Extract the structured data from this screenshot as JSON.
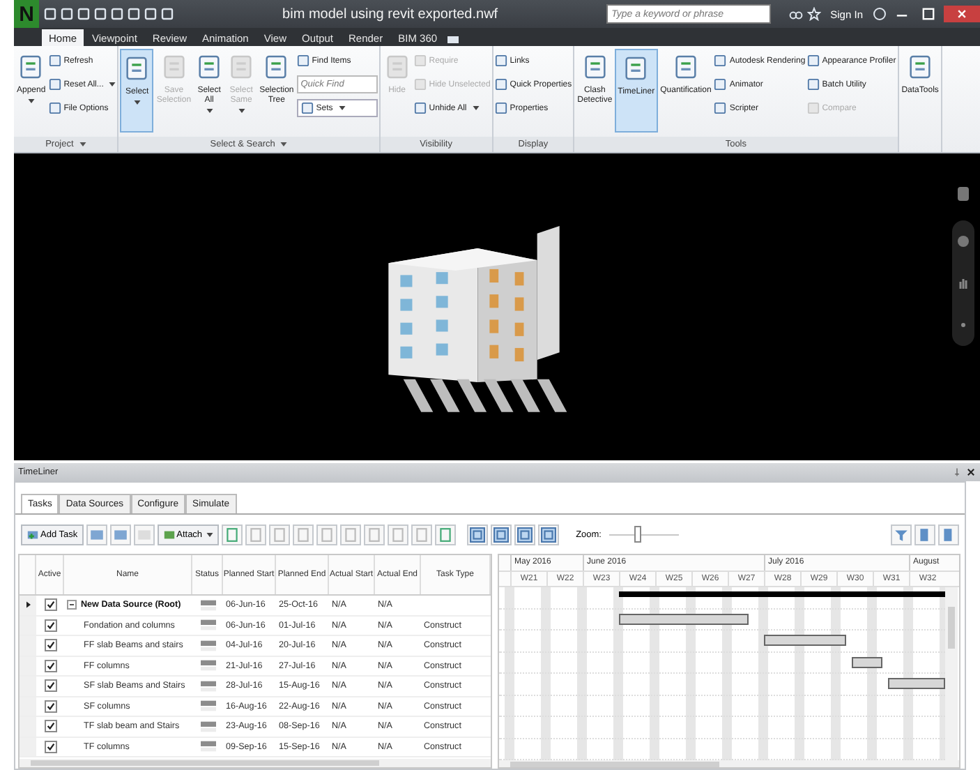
{
  "window": {
    "app_letter": "N",
    "title": "bim model using revit exported.nwf"
  },
  "search": {
    "placeholder": "Type a keyword or phrase"
  },
  "sign_in": "Sign In",
  "ribbon_tabs": [
    {
      "label": "Home",
      "selected": true
    },
    {
      "label": "Viewpoint",
      "selected": false
    },
    {
      "label": "Review",
      "selected": false
    },
    {
      "label": "Animation",
      "selected": false
    },
    {
      "label": "View",
      "selected": false
    },
    {
      "label": "Output",
      "selected": false
    },
    {
      "label": "Render",
      "selected": false
    },
    {
      "label": "BIM 360",
      "selected": false
    }
  ],
  "ribbon_groups": [
    {
      "label": "Project",
      "caret": true,
      "items": [
        {
          "kind": "large",
          "label": "Append",
          "selected": false,
          "disabled": false,
          "caret": true
        },
        {
          "kind": "stack",
          "items": [
            {
              "kind": "button",
              "label": "Refresh",
              "disabled": false,
              "caret": false
            },
            {
              "kind": "button",
              "label": "Reset All...",
              "disabled": false,
              "caret": true
            },
            {
              "kind": "button",
              "label": "File Options",
              "disabled": false,
              "caret": false
            }
          ]
        }
      ]
    },
    {
      "label": "Select & Search",
      "caret": true,
      "items": [
        {
          "kind": "large",
          "label": "Select",
          "selected": true,
          "disabled": false,
          "caret": true
        },
        {
          "kind": "large",
          "label": "Save Selection",
          "selected": false,
          "disabled": true,
          "caret": false
        },
        {
          "kind": "large",
          "label": "Select All",
          "selected": false,
          "disabled": false,
          "caret": true
        },
        {
          "kind": "large",
          "label": "Select Same",
          "selected": false,
          "disabled": true,
          "caret": true
        },
        {
          "kind": "large",
          "label": "Selection Tree",
          "selected": false,
          "disabled": false,
          "caret": false
        },
        {
          "kind": "stack",
          "items": [
            {
              "kind": "button",
              "label": "Find Items",
              "disabled": false,
              "caret": false
            },
            {
              "kind": "field",
              "placeholder": "Quick Find"
            },
            {
              "kind": "dropdown",
              "label": "Sets",
              "disabled": false,
              "caret": true
            }
          ]
        }
      ]
    },
    {
      "label": "Visibility",
      "caret": false,
      "items": [
        {
          "kind": "large",
          "label": "Hide",
          "selected": false,
          "disabled": true,
          "caret": false
        },
        {
          "kind": "stack",
          "items": [
            {
              "kind": "button",
              "label": "Require",
              "disabled": true,
              "caret": false
            },
            {
              "kind": "button",
              "label": "Hide Unselected",
              "disabled": true,
              "caret": false
            },
            {
              "kind": "button",
              "label": "Unhide All",
              "disabled": false,
              "caret": true
            }
          ]
        }
      ]
    },
    {
      "label": "Display",
      "caret": false,
      "items": [
        {
          "kind": "stack",
          "items": [
            {
              "kind": "button",
              "label": "Links",
              "disabled": false,
              "caret": false
            },
            {
              "kind": "button",
              "label": "Quick Properties",
              "disabled": false,
              "caret": false
            },
            {
              "kind": "button",
              "label": "Properties",
              "disabled": false,
              "caret": false
            }
          ]
        }
      ]
    },
    {
      "label": "Tools",
      "caret": false,
      "items": [
        {
          "kind": "large",
          "label": "Clash Detective",
          "selected": false,
          "disabled": false,
          "caret": false
        },
        {
          "kind": "large",
          "label": "TimeLiner",
          "selected": true,
          "disabled": false,
          "caret": false
        },
        {
          "kind": "large",
          "label": "Quantification",
          "selected": false,
          "disabled": false,
          "caret": false
        },
        {
          "kind": "stack",
          "items": [
            {
              "kind": "button",
              "label": "Autodesk Rendering",
              "disabled": false,
              "caret": false
            },
            {
              "kind": "button",
              "label": "Animator",
              "disabled": false,
              "caret": false
            },
            {
              "kind": "button",
              "label": "Scripter",
              "disabled": false,
              "caret": false
            }
          ]
        },
        {
          "kind": "stack",
          "items": [
            {
              "kind": "button",
              "label": "Appearance Profiler",
              "disabled": false,
              "caret": false
            },
            {
              "kind": "button",
              "label": "Batch Utility",
              "disabled": false,
              "caret": false
            },
            {
              "kind": "button",
              "label": "Compare",
              "disabled": true,
              "caret": false
            }
          ]
        }
      ]
    },
    {
      "items": [
        {
          "kind": "large",
          "label": "DataTools",
          "selected": false,
          "disabled": false,
          "caret": false
        }
      ]
    }
  ],
  "timeliner": {
    "title": "TimeLiner",
    "tabs": [
      {
        "label": "Tasks",
        "selected": true
      },
      {
        "label": "Data Sources",
        "selected": false
      },
      {
        "label": "Configure",
        "selected": false
      },
      {
        "label": "Simulate",
        "selected": false
      }
    ],
    "add_task": "Add Task",
    "attach": "Attach",
    "zoom": {
      "label": "Zoom:",
      "level": 0.4
    },
    "columns": [
      "Active",
      "Name",
      "Status",
      "Planned Start",
      "Planned End",
      "Actual Start",
      "Actual End",
      "Task Type"
    ],
    "months": [
      {
        "label": "May 2016",
        "weeks": [
          "W21",
          "W22"
        ]
      },
      {
        "label": "June 2016",
        "weeks": [
          "W23",
          "W24",
          "W25",
          "W26",
          "W27"
        ]
      },
      {
        "label": "July 2016",
        "weeks": [
          "W28",
          "W29",
          "W30",
          "W31"
        ]
      },
      {
        "label": "August",
        "weeks": [
          "W32"
        ]
      }
    ],
    "rows": [
      {
        "name": "New Data Source (Root)",
        "current": true,
        "active": true,
        "expanded": true,
        "planned_start": "06-Jun-16",
        "planned_end": "25-Oct-16",
        "actual_start": "N/A",
        "actual_end": "N/A",
        "children": [
          {
            "name": "Fondation and columns",
            "current": false,
            "active": true,
            "planned_start": "06-Jun-16",
            "planned_end": "01-Jul-16",
            "actual_start": "N/A",
            "actual_end": "N/A",
            "task_type": "Construct"
          },
          {
            "name": "FF slab Beams and stairs",
            "current": false,
            "active": true,
            "planned_start": "04-Jul-16",
            "planned_end": "20-Jul-16",
            "actual_start": "N/A",
            "actual_end": "N/A",
            "task_type": "Construct"
          },
          {
            "name": "FF columns",
            "current": false,
            "active": true,
            "planned_start": "21-Jul-16",
            "planned_end": "27-Jul-16",
            "actual_start": "N/A",
            "actual_end": "N/A",
            "task_type": "Construct"
          },
          {
            "name": "SF slab Beams and Stairs",
            "current": false,
            "active": true,
            "planned_start": "28-Jul-16",
            "planned_end": "15-Aug-16",
            "actual_start": "N/A",
            "actual_end": "N/A",
            "task_type": "Construct"
          },
          {
            "name": "SF columns",
            "current": false,
            "active": true,
            "planned_start": "16-Aug-16",
            "planned_end": "22-Aug-16",
            "actual_start": "N/A",
            "actual_end": "N/A",
            "task_type": "Construct"
          },
          {
            "name": "TF slab beam and Stairs",
            "current": false,
            "active": true,
            "planned_start": "23-Aug-16",
            "planned_end": "08-Sep-16",
            "actual_start": "N/A",
            "actual_end": "N/A",
            "task_type": "Construct"
          },
          {
            "name": "TF columns",
            "current": false,
            "active": true,
            "planned_start": "09-Sep-16",
            "planned_end": "15-Sep-16",
            "actual_start": "N/A",
            "actual_end": "N/A",
            "task_type": "Construct"
          }
        ]
      }
    ]
  }
}
